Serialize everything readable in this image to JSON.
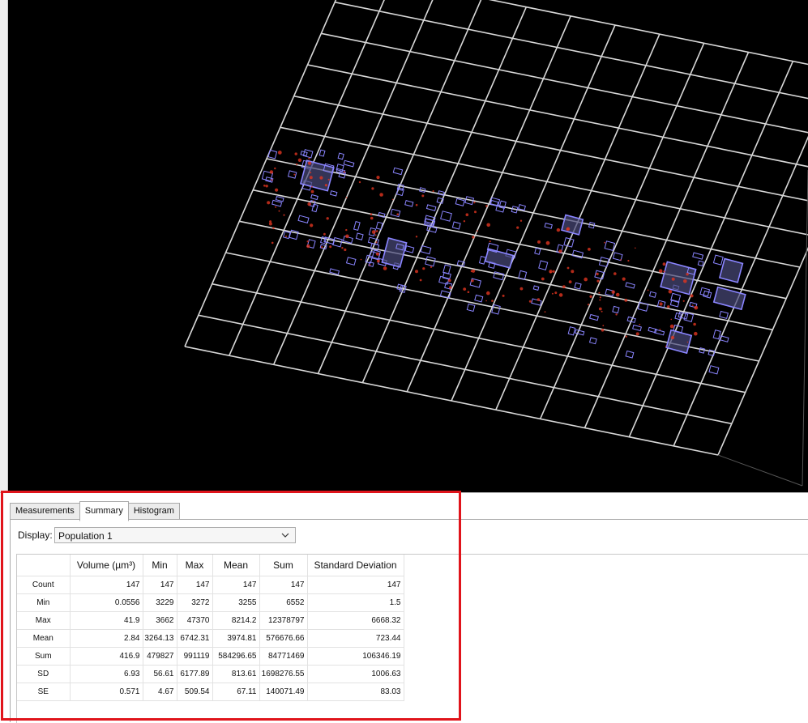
{
  "tabs": [
    {
      "label": "Measurements",
      "active": false
    },
    {
      "label": "Summary",
      "active": true
    },
    {
      "label": "Histogram",
      "active": false
    }
  ],
  "display": {
    "label": "Display:",
    "value": "Population 1"
  },
  "table": {
    "columns": [
      "",
      "Volume (µm³)",
      "Min",
      "Max",
      "Mean",
      "Sum",
      "Standard Deviation"
    ],
    "rows": [
      {
        "label": "Count",
        "values": [
          "147",
          "147",
          "147",
          "147",
          "147",
          "147"
        ]
      },
      {
        "label": "Min",
        "values": [
          "0.0556",
          "3229",
          "3272",
          "3255",
          "6552",
          "1.5"
        ]
      },
      {
        "label": "Max",
        "values": [
          "41.9",
          "3662",
          "47370",
          "8214.2",
          "12378797",
          "6668.32"
        ]
      },
      {
        "label": "Mean",
        "values": [
          "2.84",
          "3264.13",
          "6742.31",
          "3974.81",
          "576676.66",
          "723.44"
        ]
      },
      {
        "label": "Sum",
        "values": [
          "416.9",
          "479827",
          "991119",
          "584296.65",
          "84771469",
          "106346.19"
        ]
      },
      {
        "label": "SD",
        "values": [
          "6.93",
          "56.61",
          "6177.89",
          "813.61",
          "1698276.55",
          "1006.63"
        ]
      },
      {
        "label": "SE",
        "values": [
          "0.571",
          "4.67",
          "509.54",
          "67.11",
          "140071.49",
          "83.03"
        ]
      }
    ]
  },
  "colors": {
    "highlight": "#e0141b",
    "grid": "#d8d8d8",
    "object_box": "#8a85ff",
    "signal": "#e0341f",
    "viewport_bg": "#000000"
  },
  "icons": {
    "display_dropdown": "chevron-down-icon"
  }
}
